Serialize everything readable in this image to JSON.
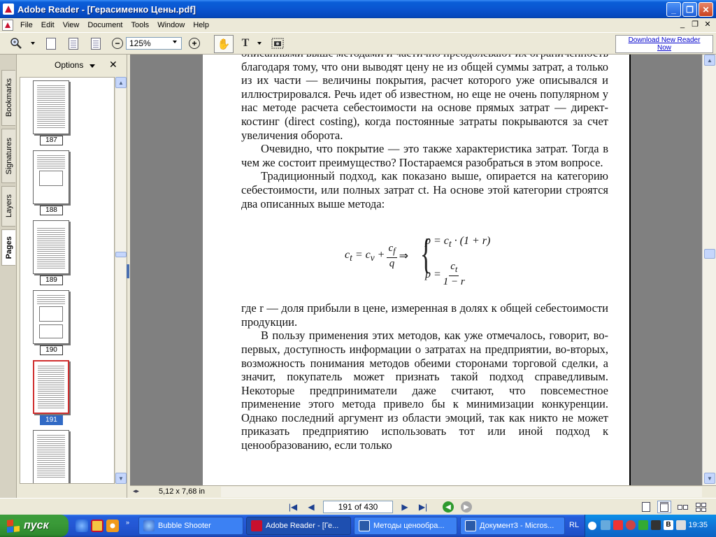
{
  "window": {
    "title": "Adobe Reader - [Герасименко Цены.pdf]"
  },
  "menu": [
    "File",
    "Edit",
    "View",
    "Document",
    "Tools",
    "Window",
    "Help"
  ],
  "toolbar": {
    "zoom": "125%",
    "download_link": "Download New Reader Now"
  },
  "left_panel": {
    "tabs": [
      "Bookmarks",
      "Signatures",
      "Layers",
      "Pages"
    ],
    "active_tab": "Pages",
    "options_label": "Options",
    "thumbnails": [
      {
        "label": "187",
        "current": false
      },
      {
        "label": "188",
        "current": false
      },
      {
        "label": "189",
        "current": false
      },
      {
        "label": "190",
        "current": false
      },
      {
        "label": "191",
        "current": true
      },
      {
        "label": "",
        "current": false
      }
    ]
  },
  "document": {
    "paragraphs": [
      "описанными выше методами и частично преодолевают их ограниченность благодаря тому, что они выводят цену не из общей суммы затрат, а только из их части — величины покрытия, расчет которого уже описывался и иллюстрировался. Речь идет об известном, но еще не очень популярном у нас методе расчета себестоимости на основе прямых затрат — директ-костинг (direct costing), когда постоянные затраты покрываются за счет увеличения оборота.",
      "Очевидно, что покрытие — это также характеристика затрат. Тогда в чем же состоит преимущество? Постараемся разобраться в этом вопросе.",
      "Традиционный подход, как показано выше, опирается на категорию себестоимости, или полных затрат ct. На основе этой категории строятся два описанных выше метода:",
      "где r — доля прибыли в цене, измеренная в долях к общей себестоимости продукции.",
      "В пользу применения этих методов, как уже отмечалось, говорит, во-первых, доступность информации о затратах на предприятии, во-вторых, возможность понимания методов обеими сторонами торговой сделки, а значит, покупатель может признать такой подход справедливым. Некоторые предприниматели даже считают, что повсеместное применение этого метода привело бы к минимизации конкуренции. Однако последний аргумент из области эмоций, так как никто не может приказать предприятию использовать тот или иной подход к ценообразованию, если только"
    ],
    "page_size": "5,12 x 7,68 in"
  },
  "navigation": {
    "page_indicator": "191 of 430"
  },
  "taskbar": {
    "start_label": "пуск",
    "tasks": [
      {
        "label": "Bubble Shooter",
        "active": false
      },
      {
        "label": "Adobe Reader - [Ге...",
        "active": true
      },
      {
        "label": "Методы ценообра...",
        "active": false
      },
      {
        "label": "Документ3 - Micros...",
        "active": false
      }
    ],
    "language": "RL",
    "clock": "19:35"
  }
}
